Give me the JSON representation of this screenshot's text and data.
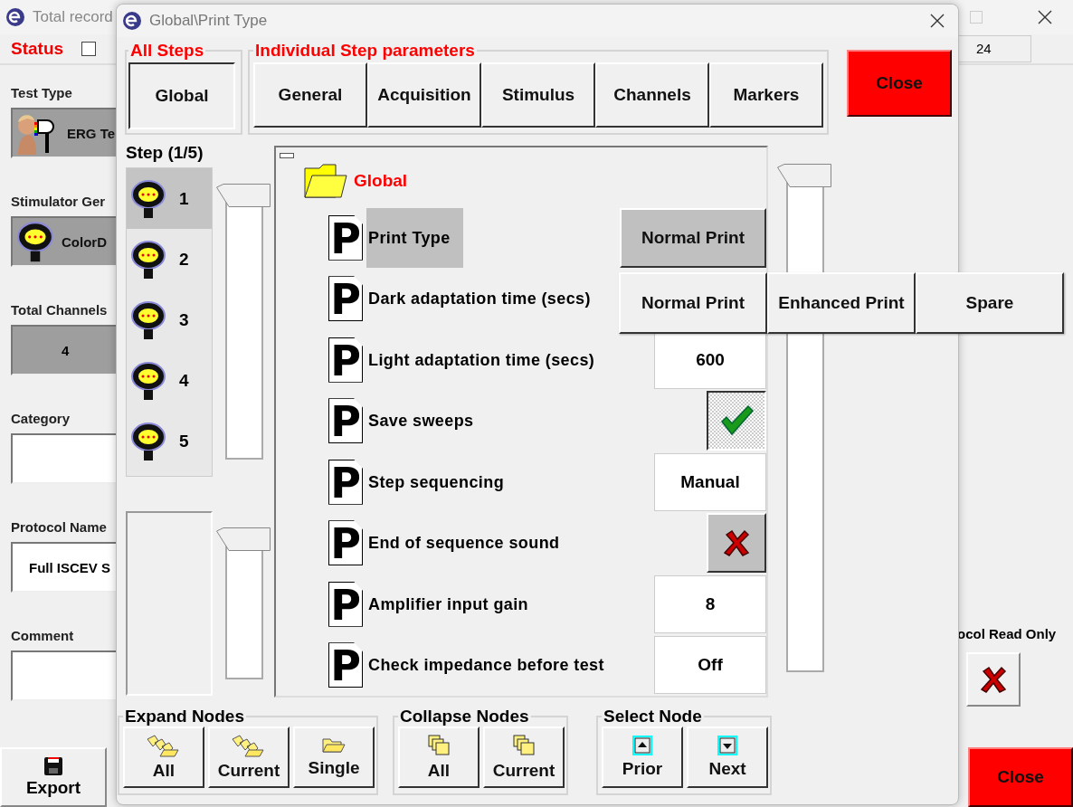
{
  "background_window": {
    "title": "Total record",
    "status_label": "Status",
    "status_checkbox": {
      "checked": false
    },
    "top_right_field": "24",
    "fields": [
      {
        "label": "Test Type",
        "value": "ERG Te",
        "kind": "test"
      },
      {
        "label": "Stimulator Ger",
        "value": "ColorD",
        "kind": "stimulator"
      },
      {
        "label": "Total Channels",
        "value": "4",
        "kind": "readonly"
      },
      {
        "label": "Category",
        "kind": "text"
      },
      {
        "label": "Protocol Name",
        "value": "Full ISCEV S",
        "kind": "text"
      },
      {
        "label": "Comment",
        "kind": "text"
      }
    ],
    "read_only": {
      "label": "ocol Read Only",
      "checked": false
    },
    "export_button": "Export",
    "close_button": "Close"
  },
  "dialog": {
    "title": "Global\\Print Type",
    "all_steps": {
      "legend": "All Steps",
      "button": {
        "label": "Global",
        "selected": true
      }
    },
    "step_parameters": {
      "legend": "Individual Step parameters",
      "tabs": [
        {
          "label": "General",
          "selected": false
        },
        {
          "label": "Acquisition",
          "selected": false
        },
        {
          "label": "Stimulus",
          "selected": false
        },
        {
          "label": "Channels",
          "selected": false
        },
        {
          "label": "Markers",
          "selected": false
        }
      ]
    },
    "close_button": "Close",
    "step_label": "Step (1/5)",
    "steps": [
      {
        "label": "1",
        "selected": true
      },
      {
        "label": "2",
        "selected": false
      },
      {
        "label": "3",
        "selected": false
      },
      {
        "label": "4",
        "selected": false
      },
      {
        "label": "5",
        "selected": false
      }
    ],
    "tree": {
      "root": {
        "label": "Global",
        "expanded": true
      },
      "params": [
        {
          "label": "Print Type",
          "icon_letter": "P",
          "selected": true,
          "kind": "dropdown",
          "value": "Normal Print"
        },
        {
          "label": "Dark adaptation time (secs)",
          "icon_letter": "P",
          "selected": false,
          "kind": "covered"
        },
        {
          "label": "Light adaptation time (secs)",
          "icon_letter": "P",
          "selected": false,
          "kind": "text",
          "value": "600"
        },
        {
          "label": "Save sweeps",
          "icon_letter": "P",
          "selected": false,
          "kind": "check",
          "checked": true
        },
        {
          "label": "Step sequencing",
          "icon_letter": "P",
          "selected": false,
          "kind": "text",
          "value": "Manual"
        },
        {
          "label": "End of sequence sound",
          "icon_letter": "P",
          "selected": false,
          "kind": "check",
          "checked": false
        },
        {
          "label": "Amplifier input gain",
          "icon_letter": "P",
          "selected": false,
          "kind": "text",
          "value": "8"
        },
        {
          "label": "Check impedance before test",
          "icon_letter": "P",
          "selected": false,
          "kind": "text",
          "value": "Off"
        }
      ]
    },
    "dropdown_menu": {
      "options": [
        {
          "label": "Normal Print"
        },
        {
          "label": "Enhanced Print"
        },
        {
          "label": "Spare"
        }
      ]
    },
    "expand_nodes": {
      "legend": "Expand Nodes",
      "buttons": [
        {
          "label": "All",
          "kind": "expand-all"
        },
        {
          "label": "Current",
          "kind": "expand-current"
        },
        {
          "label": "Single",
          "kind": "expand-single"
        }
      ]
    },
    "collapse_nodes": {
      "legend": "Collapse Nodes",
      "buttons": [
        {
          "label": "All",
          "kind": "collapse"
        },
        {
          "label": "Current",
          "kind": "collapse"
        }
      ]
    },
    "select_node": {
      "legend": "Select Node",
      "buttons": [
        {
          "label": "Prior",
          "kind": "up"
        },
        {
          "label": "Next",
          "kind": "down"
        }
      ]
    }
  }
}
